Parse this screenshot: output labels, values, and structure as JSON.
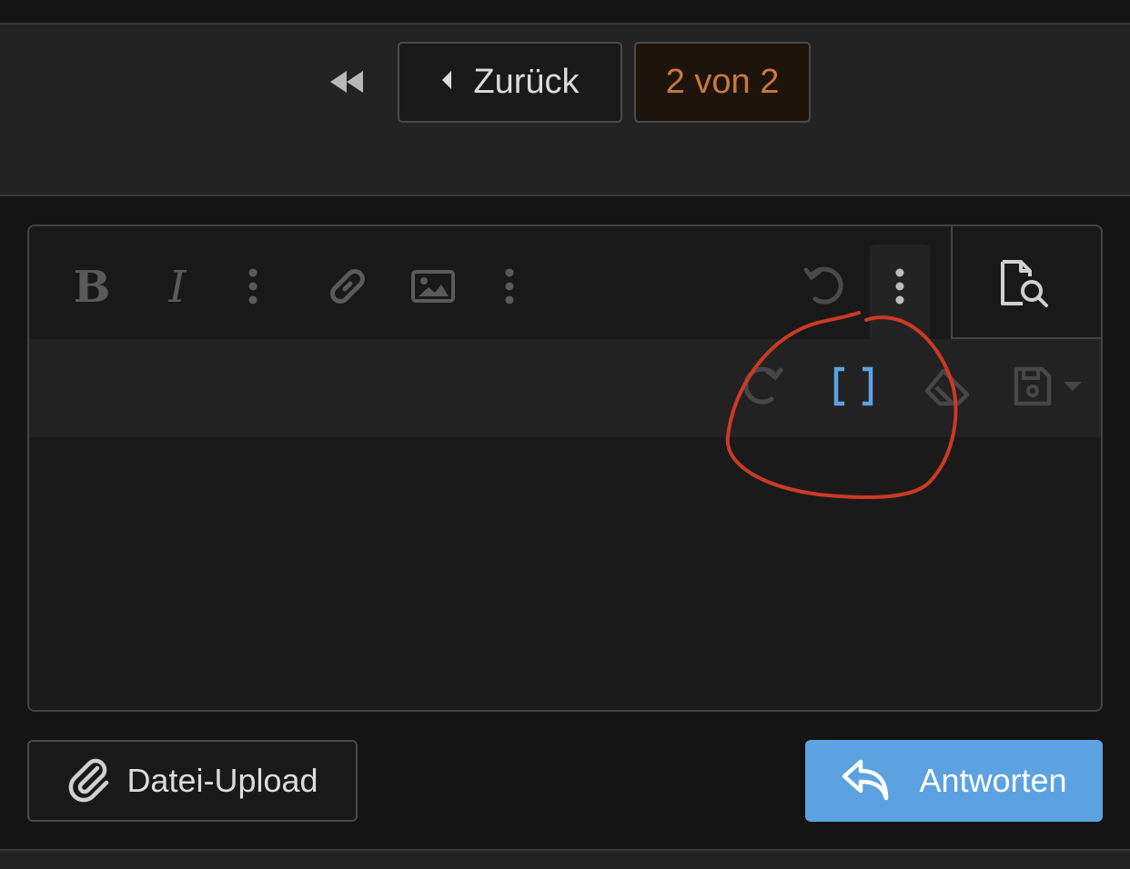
{
  "pagination": {
    "first_icon": "double-chevron-left-icon",
    "prev_icon": "caret-left-icon",
    "prev_label": "Zurück",
    "page_indicator": "2 von 2"
  },
  "editor": {
    "toolbar_main": [
      {
        "name": "bold",
        "icon": "bold-icon"
      },
      {
        "name": "italic",
        "icon": "italic-icon"
      },
      {
        "name": "more-text",
        "icon": "vertical-ellipsis-icon"
      },
      {
        "name": "link",
        "icon": "link-icon"
      },
      {
        "name": "image",
        "icon": "image-icon"
      },
      {
        "name": "more-insert",
        "icon": "vertical-ellipsis-icon"
      },
      {
        "name": "undo",
        "icon": "undo-icon"
      },
      {
        "name": "more-misc",
        "icon": "vertical-ellipsis-icon"
      }
    ],
    "preview_icon": "document-search-icon",
    "toolbar_misc": [
      {
        "name": "redo",
        "icon": "redo-icon"
      },
      {
        "name": "bbcode-toggle",
        "icon": "brackets-icon"
      },
      {
        "name": "remove-format",
        "icon": "eraser-icon"
      },
      {
        "name": "drafts",
        "icon": "floppy-disk-icon"
      }
    ]
  },
  "actions": {
    "upload_icon": "paperclip-icon",
    "upload_label": "Datei-Upload",
    "reply_icon": "reply-arrow-icon",
    "reply_label": "Antworten"
  },
  "colors": {
    "accent": "#5da2e0",
    "page_indicator_text": "#c77a3c",
    "annotation": "#cc3a24"
  }
}
